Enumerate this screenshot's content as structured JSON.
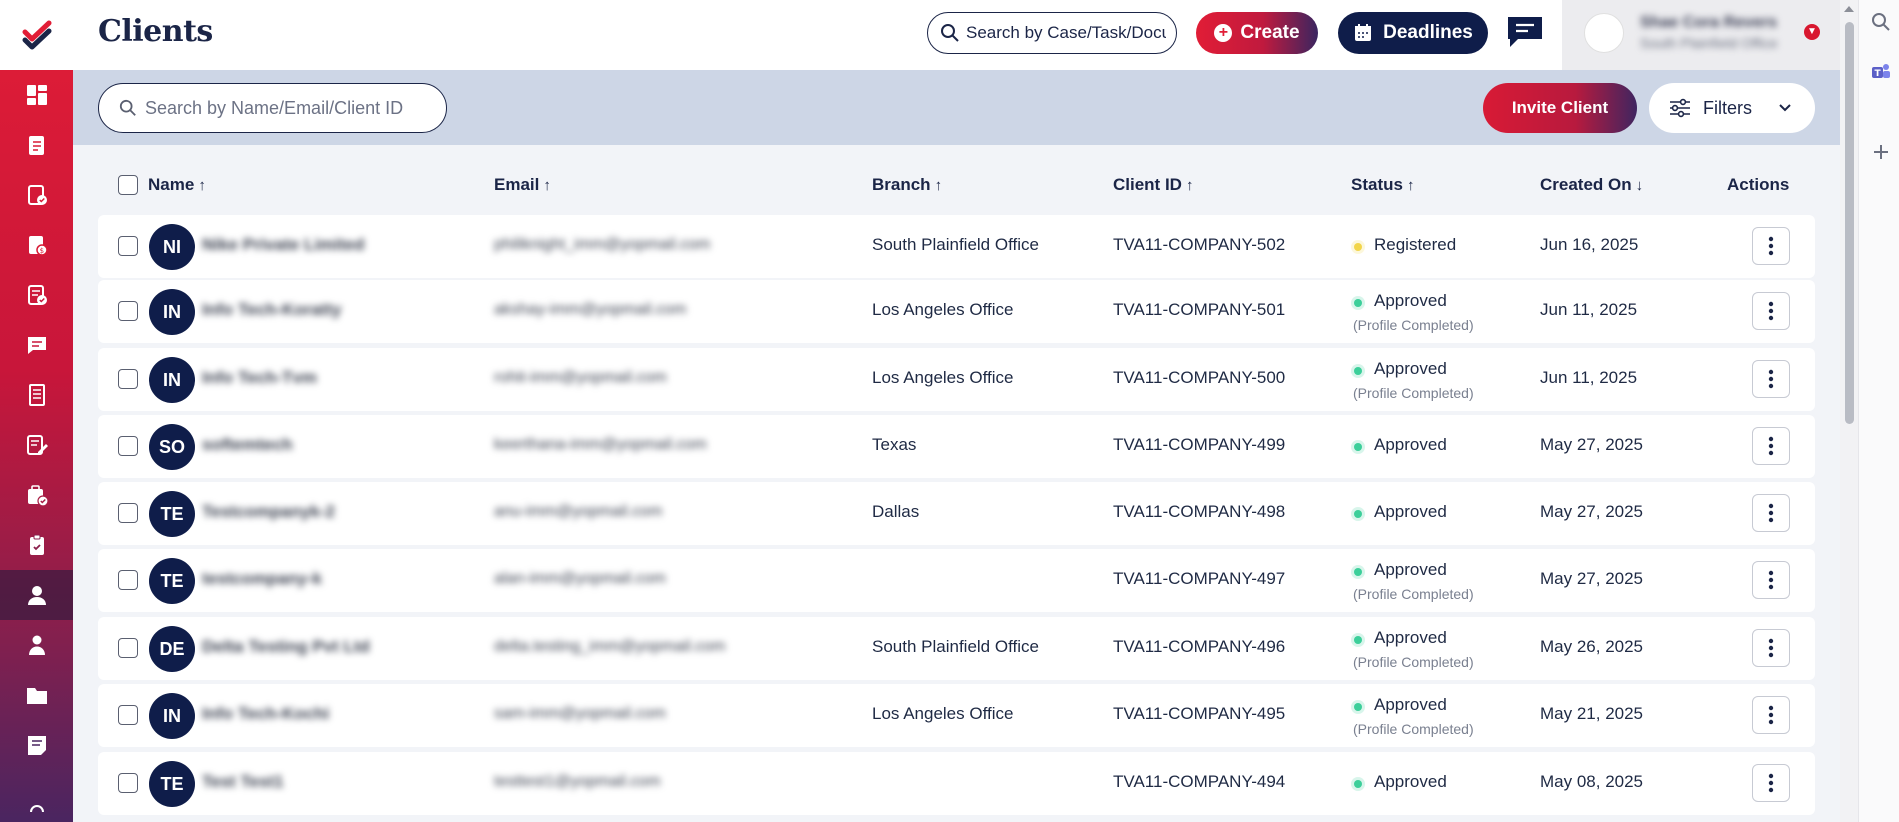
{
  "header": {
    "title": "Clients",
    "search_placeholder": "Search by Case/Task/Document",
    "create_label": "Create",
    "deadlines_label": "Deadlines"
  },
  "user": {
    "name": "Shae Cora Revers",
    "office": "South Plainfield Office"
  },
  "toolbar": {
    "search_placeholder": "Search by Name/Email/Client ID",
    "invite_label": "Invite Client",
    "filters_label": "Filters"
  },
  "sidebar": {
    "items": [
      {
        "icon": "dashboard-icon"
      },
      {
        "icon": "document-icon"
      },
      {
        "icon": "case-check-icon"
      },
      {
        "icon": "invoice-icon"
      },
      {
        "icon": "task-check-icon"
      },
      {
        "icon": "message-icon"
      },
      {
        "icon": "ledger-icon"
      },
      {
        "icon": "edit-form-icon"
      },
      {
        "icon": "briefcase-check-icon"
      },
      {
        "icon": "clipboard-icon"
      },
      {
        "icon": "clients-icon",
        "active": true
      },
      {
        "icon": "user-icon"
      },
      {
        "icon": "folder-icon"
      },
      {
        "icon": "notes-icon"
      },
      {
        "icon": "more-icon"
      }
    ]
  },
  "table": {
    "columns": {
      "name": "Name",
      "email": "Email",
      "branch": "Branch",
      "client_id": "Client ID",
      "status": "Status",
      "created_on": "Created On",
      "actions": "Actions"
    },
    "rows": [
      {
        "initials": "NI",
        "name": "Nike Private Limited",
        "email": "philiknight_imm@yopmail.com",
        "branch": "South Plainfield Office",
        "client_id": "TVA11-COMPANY-502",
        "status": "Registered",
        "status_color": "#f2d54a",
        "status_sub": "",
        "created_on": "Jun 16, 2025"
      },
      {
        "initials": "IN",
        "name": "Info Tech-Koratty",
        "email": "akshay-imm@yopmail.com",
        "branch": "Los Angeles Office",
        "client_id": "TVA11-COMPANY-501",
        "status": "Approved",
        "status_color": "#3ccf9a",
        "status_sub": "(Profile Completed)",
        "created_on": "Jun 11, 2025"
      },
      {
        "initials": "IN",
        "name": "Info Tech-Tvm",
        "email": "rohit-imm@yopmail.com",
        "branch": "Los Angeles Office",
        "client_id": "TVA11-COMPANY-500",
        "status": "Approved",
        "status_color": "#3ccf9a",
        "status_sub": "(Profile Completed)",
        "created_on": "Jun 11, 2025"
      },
      {
        "initials": "SO",
        "name": "softemtech",
        "email": "keerthana-imm@yopmail.com",
        "branch": "Texas",
        "client_id": "TVA11-COMPANY-499",
        "status": "Approved",
        "status_color": "#3ccf9a",
        "status_sub": "",
        "created_on": "May 27, 2025"
      },
      {
        "initials": "TE",
        "name": "Testcompanyk-2",
        "email": "anu-imm@yopmail.com",
        "branch": "Dallas",
        "client_id": "TVA11-COMPANY-498",
        "status": "Approved",
        "status_color": "#3ccf9a",
        "status_sub": "",
        "created_on": "May 27, 2025"
      },
      {
        "initials": "TE",
        "name": "testcompany-k",
        "email": "alan-imm@yopmail.com",
        "branch": "",
        "client_id": "TVA11-COMPANY-497",
        "status": "Approved",
        "status_color": "#3ccf9a",
        "status_sub": "(Profile Completed)",
        "created_on": "May 27, 2025"
      },
      {
        "initials": "DE",
        "name": "Delta Testing Pvt Ltd",
        "email": "delta.testing_imm@yopmail.com",
        "branch": "South Plainfield Office",
        "client_id": "TVA11-COMPANY-496",
        "status": "Approved",
        "status_color": "#3ccf9a",
        "status_sub": "(Profile Completed)",
        "created_on": "May 26, 2025"
      },
      {
        "initials": "IN",
        "name": "Info Tech-Kochi",
        "email": "sam-imm@yopmail.com",
        "branch": "Los Angeles Office",
        "client_id": "TVA11-COMPANY-495",
        "status": "Approved",
        "status_color": "#3ccf9a",
        "status_sub": "(Profile Completed)",
        "created_on": "May 21, 2025"
      },
      {
        "initials": "TE",
        "name": "Test Test1",
        "email": "testtest1@yopmail.com",
        "branch": "",
        "client_id": "TVA11-COMPANY-494",
        "status": "Approved",
        "status_color": "#3ccf9a",
        "status_sub": "",
        "created_on": "May 08, 2025"
      }
    ]
  },
  "colors": {
    "brand_red": "#e11d36",
    "navy": "#0f1d4a",
    "toolbar_bg": "#cdd6e6"
  }
}
